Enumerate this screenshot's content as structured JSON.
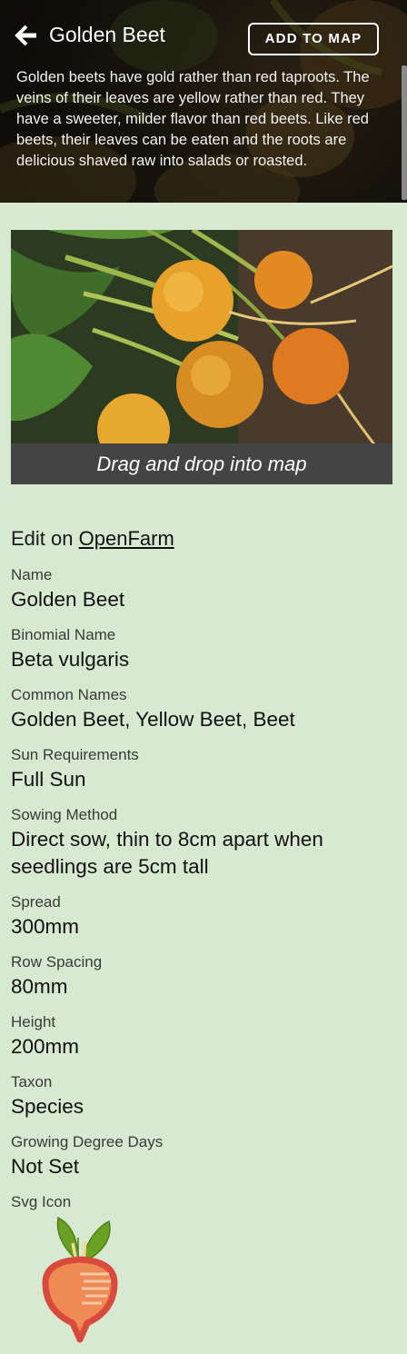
{
  "header": {
    "title": "Golden Beet",
    "add_button_label": "ADD TO MAP",
    "description": "Golden beets have gold rather than red taproots. The veins of their leaves are yellow rather than red. They have a sweeter, milder flavor than red beets. Like red beets, their leaves can be eaten and the roots are delicious shaved raw into salads or roasted."
  },
  "photo": {
    "caption": "Drag and drop into map"
  },
  "edit": {
    "prefix": "Edit on",
    "link_text": "OpenFarm"
  },
  "fields": [
    {
      "label": "Name",
      "value": "Golden Beet"
    },
    {
      "label": "Binomial Name",
      "value": "Beta vulgaris"
    },
    {
      "label": "Common Names",
      "value": "Golden Beet, Yellow Beet, Beet"
    },
    {
      "label": "Sun Requirements",
      "value": "Full Sun"
    },
    {
      "label": "Sowing Method",
      "value": "Direct sow, thin to 8cm apart when seedlings are 5cm tall"
    },
    {
      "label": "Spread",
      "value": "300mm"
    },
    {
      "label": "Row Spacing",
      "value": "80mm"
    },
    {
      "label": "Height",
      "value": "200mm"
    },
    {
      "label": "Taxon",
      "value": "Species"
    },
    {
      "label": "Growing Degree Days",
      "value": "Not Set"
    },
    {
      "label": "Svg Icon",
      "value": ""
    }
  ],
  "colors": {
    "page_background": "#d7e9d0",
    "caption_background": "#444444",
    "icon_root": "#f08a55",
    "icon_outline": "#d84a3c",
    "icon_leaf": "#6aa123"
  },
  "icons": {
    "back": "arrow-left-icon",
    "plant": "beet-icon"
  }
}
